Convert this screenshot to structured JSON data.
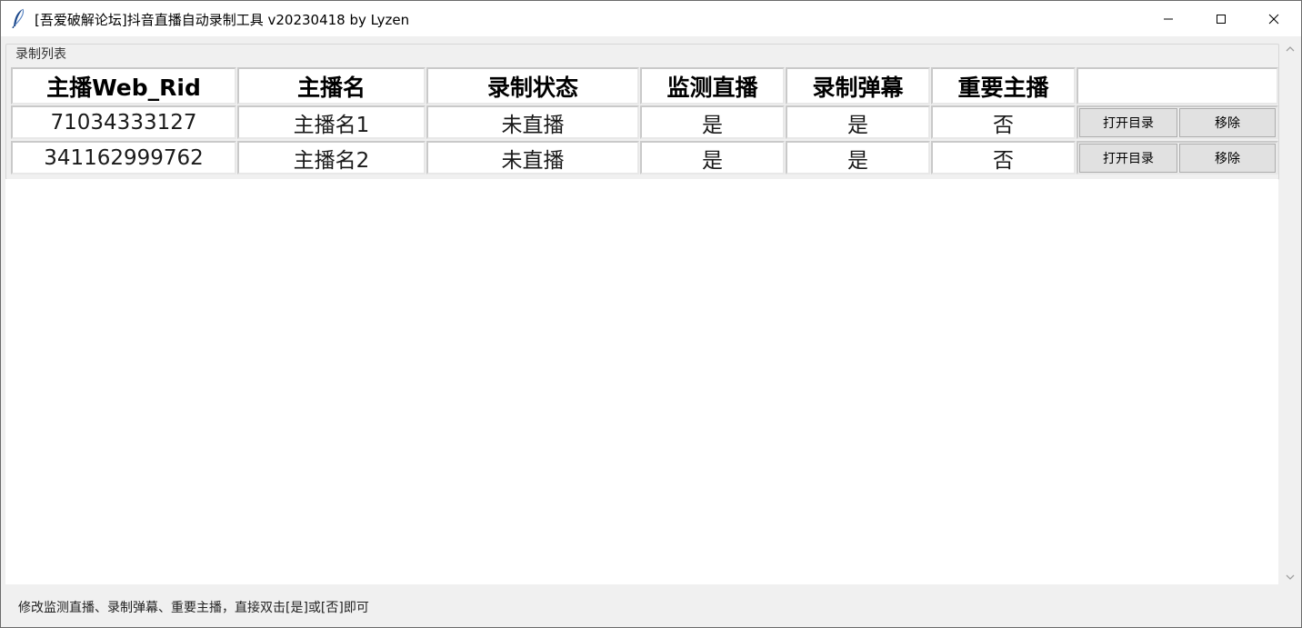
{
  "window": {
    "title": "[吾爱破解论坛]抖音直播自动录制工具 v20230418 by Lyzen",
    "icon": "feather-icon"
  },
  "group": {
    "label": "录制列表"
  },
  "table": {
    "headers": [
      "主播Web_Rid",
      "主播名",
      "录制状态",
      "监测直播",
      "录制弹幕",
      "重要主播",
      ""
    ],
    "rows": [
      {
        "web_rid": "71034333127",
        "name": "主播名1",
        "status": "未直播",
        "monitor": "是",
        "danmaku": "是",
        "important": "否",
        "open_dir_label": "打开目录",
        "remove_label": "移除"
      },
      {
        "web_rid": "341162999762",
        "name": "主播名2",
        "status": "未直播",
        "monitor": "是",
        "danmaku": "是",
        "important": "否",
        "open_dir_label": "打开目录",
        "remove_label": "移除"
      }
    ]
  },
  "status_bar": {
    "hint": "修改监测直播、录制弹幕、重要主播，直接双击[是]或[否]即可"
  }
}
